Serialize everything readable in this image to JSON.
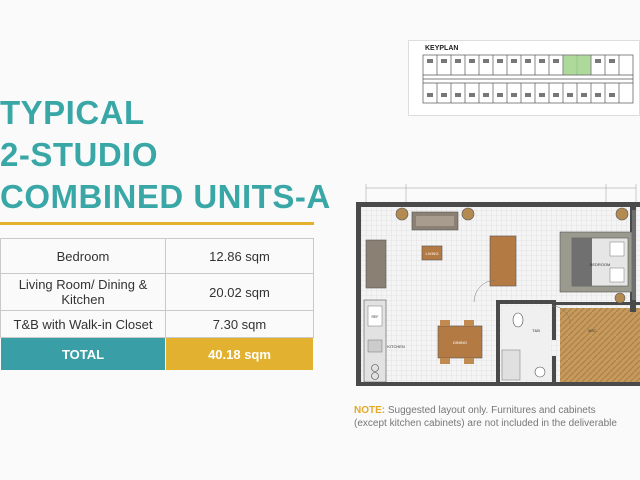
{
  "title": {
    "line1": "TYPICAL",
    "line2": "2-STUDIO",
    "line3": "COMBINED UNITS-A"
  },
  "areas": [
    {
      "name": "Bedroom",
      "value": "12.86 sqm"
    },
    {
      "name": "Living Room/ Dining & Kitchen",
      "value": "20.02 sqm"
    },
    {
      "name": "T&B with Walk-in Closet",
      "value": "7.30 sqm"
    }
  ],
  "total": {
    "label": "TOTAL",
    "value": "40.18 sqm"
  },
  "keyplan": {
    "label": "KEYPLAN"
  },
  "floorplan": {
    "rooms": {
      "living": "LIVING",
      "bedroom": "BEDROOM",
      "dining": "DINING",
      "kitchen": "KITCHEN",
      "tb": "T&B",
      "wic": "W/C",
      "ref": "REF"
    }
  },
  "note": {
    "label": "NOTE:",
    "line1": "Suggested layout only. Furnitures and cabinets",
    "line2": "(except kitchen cabinets) are not included in the deliverable"
  },
  "colors": {
    "teal": "#3aa7a7",
    "gold": "#e3b12e",
    "total_bg": "#3a9ea6"
  }
}
